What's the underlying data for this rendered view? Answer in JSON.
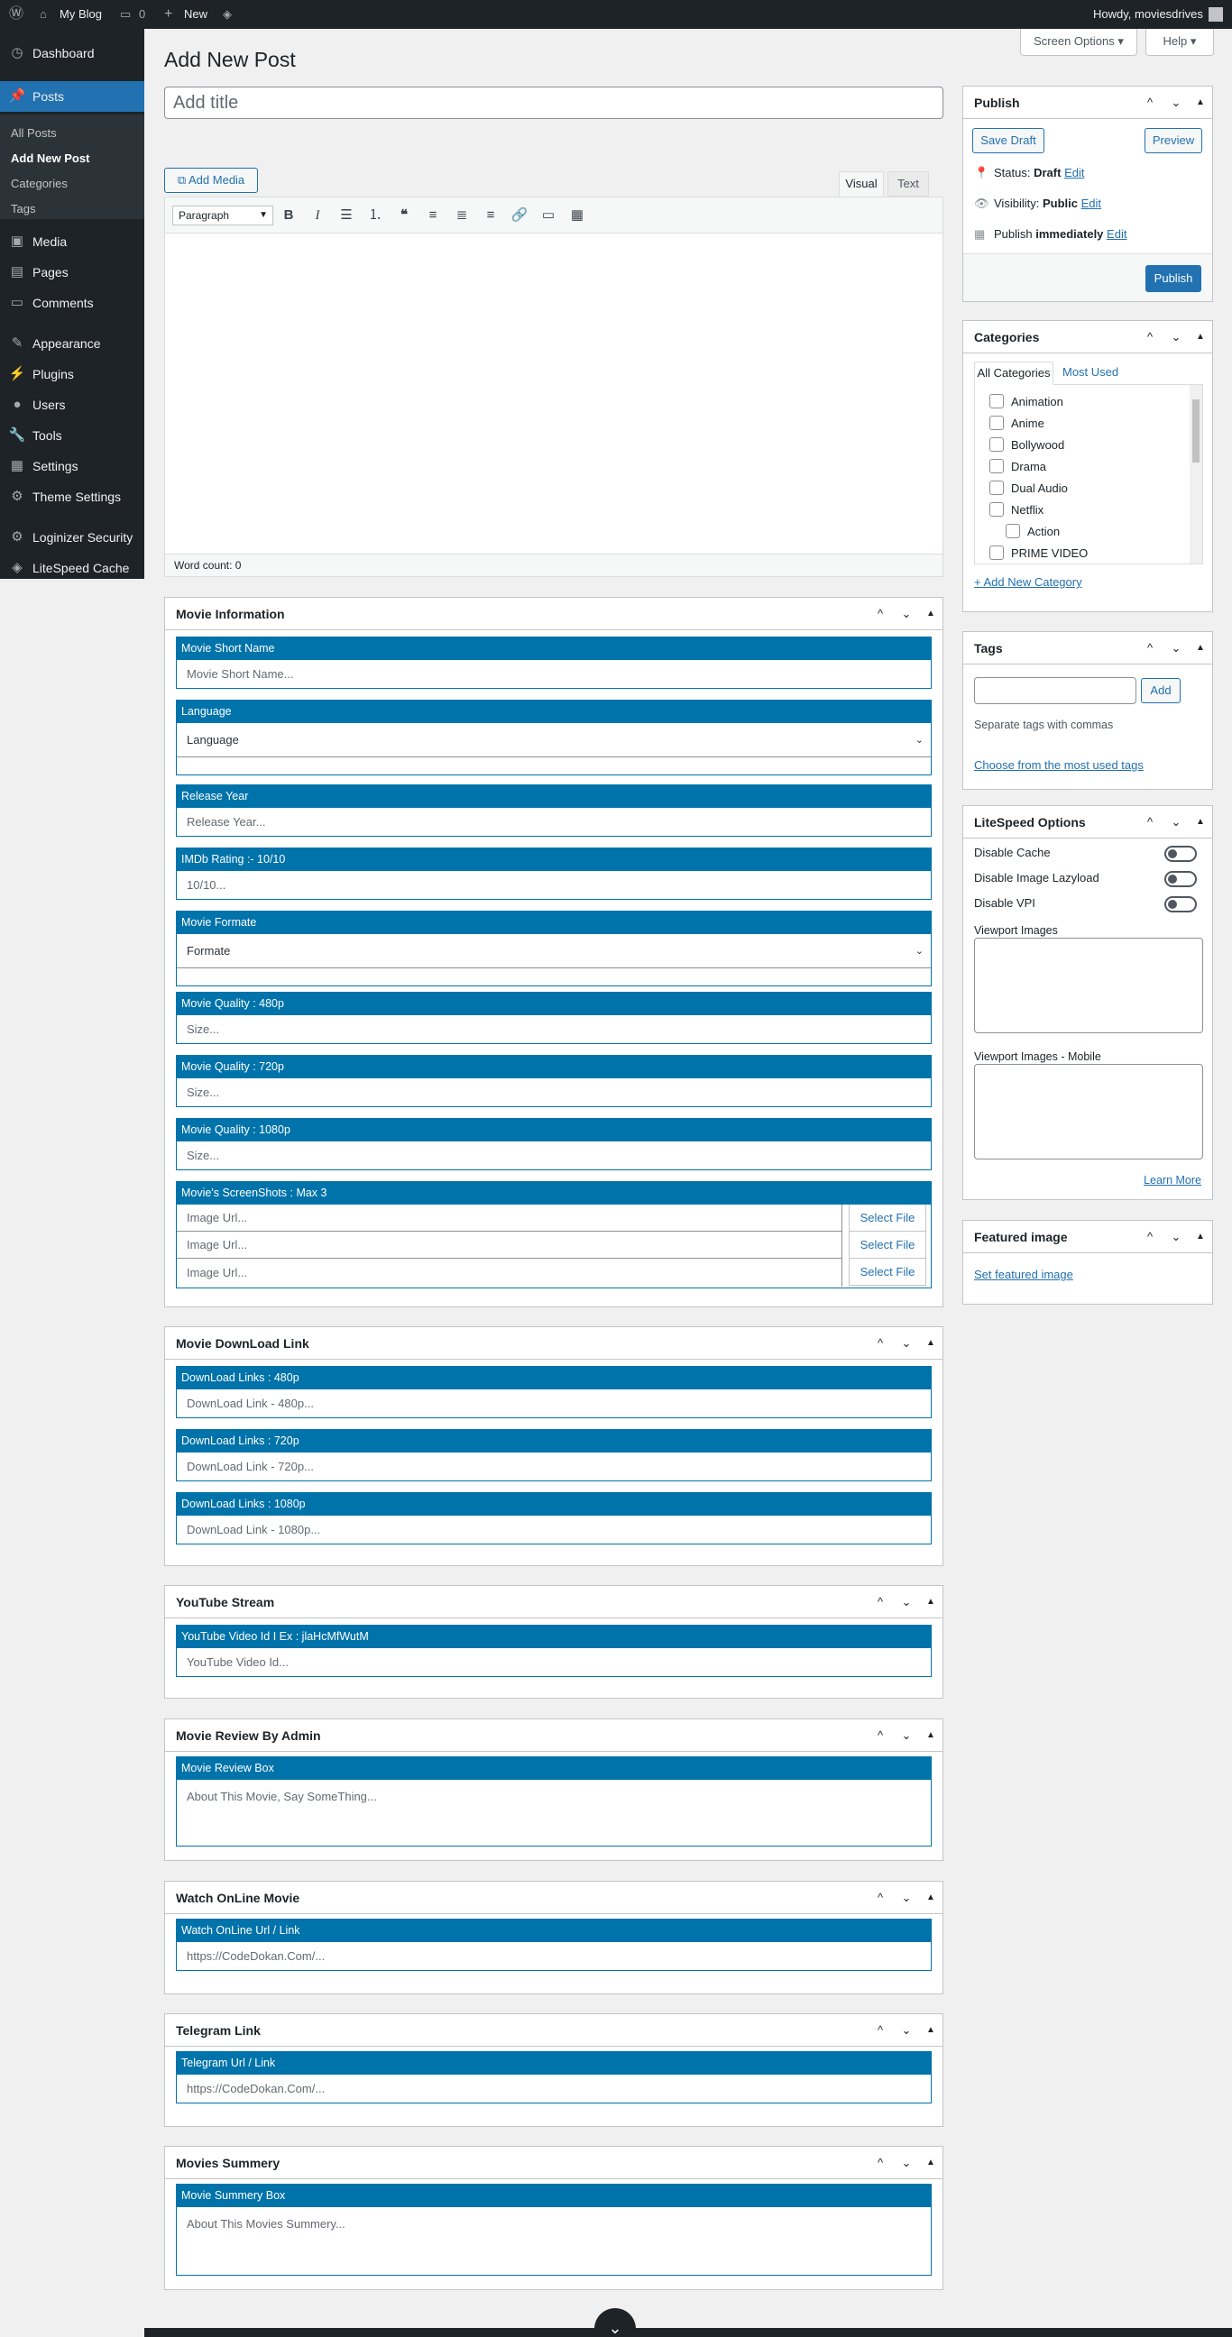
{
  "adminbar": {
    "site_name": "My Blog",
    "comments_count": "0",
    "new_label": "New",
    "howdy": "Howdy, moviesdrives"
  },
  "menu": {
    "dashboard": "Dashboard",
    "posts": "Posts",
    "sub": [
      "All Posts",
      "Add New Post",
      "Categories",
      "Tags"
    ],
    "media": "Media",
    "pages": "Pages",
    "comments": "Comments",
    "appearance": "Appearance",
    "plugins": "Plugins",
    "users": "Users",
    "tools": "Tools",
    "settings": "Settings",
    "theme_settings": "Theme Settings",
    "loginizer": "Loginizer Security",
    "litespeed": "LiteSpeed Cache"
  },
  "screen_options": "Screen Options",
  "help": "Help",
  "page_title": "Add New Post",
  "title_placeholder": "Add title",
  "editor": {
    "add_media": "Add Media",
    "tab_visual": "Visual",
    "tab_text": "Text",
    "format": "Paragraph",
    "word_count": "Word count: 0"
  },
  "publish": {
    "title": "Publish",
    "save_draft": "Save Draft",
    "preview": "Preview",
    "status_label": "Status:",
    "status_value": "Draft",
    "visibility_label": "Visibility:",
    "visibility_value": "Public",
    "publish_when": "Publish",
    "publish_when_value": "immediately",
    "edit": "Edit",
    "publish_button": "Publish"
  },
  "categories": {
    "title": "Categories",
    "tab_all": "All Categories",
    "tab_most": "Most Used",
    "items": [
      "Animation",
      "Anime",
      "Bollywood",
      "Drama",
      "Dual Audio",
      "Netflix",
      "Action",
      "PRIME VIDEO"
    ],
    "add_new": "+ Add New Category"
  },
  "tags": {
    "title": "Tags",
    "add": "Add",
    "hint": "Separate tags with commas",
    "choose": "Choose from the most used tags"
  },
  "litespeed": {
    "title": "LiteSpeed Options",
    "disable_cache": "Disable Cache",
    "disable_lazy": "Disable Image Lazyload",
    "disable_vpi": "Disable VPI",
    "viewport": "Viewport Images",
    "viewport_mobile": "Viewport Images - Mobile",
    "learn_more": "Learn More"
  },
  "featured": {
    "title": "Featured image",
    "set": "Set featured image"
  },
  "movie_info": {
    "title": "Movie Information",
    "short_name_label": "Movie Short Name",
    "short_name_ph": "Movie Short Name...",
    "language_label": "Language",
    "language_value": "Language",
    "year_label": "Release Year",
    "year_ph": "Release Year...",
    "imdb_label": "IMDb Rating :- 10/10",
    "imdb_ph": "10/10...",
    "formate_label": "Movie Formate",
    "formate_value": "Formate",
    "q480_label": "Movie Quality : 480p",
    "q720_label": "Movie Quality : 720p",
    "q1080_label": "Movie Quality : 1080p",
    "size_ph": "Size...",
    "shots_label": "Movie's ScreenShots : Max 3",
    "image_ph": "Image Url...",
    "select_file": "Select File"
  },
  "download": {
    "title": "Movie DownLoad Link",
    "l480": "DownLoad Links : 480p",
    "p480": "DownLoad Link - 480p...",
    "l720": "DownLoad Links : 720p",
    "p720": "DownLoad Link - 720p...",
    "l1080": "DownLoad Links : 1080p",
    "p1080": "DownLoad Link - 1080p..."
  },
  "youtube": {
    "title": "YouTube Stream",
    "label": "YouTube Video Id I Ex : jlaHcMfWutM",
    "ph": "YouTube Video Id..."
  },
  "review": {
    "title": "Movie Review By Admin",
    "label": "Movie Review Box",
    "ph": "About This Movie, Say SomeThing..."
  },
  "watch": {
    "title": "Watch OnLine Movie",
    "label": "Watch OnLine Url / Link",
    "ph": "https://CodeDokan.Com/..."
  },
  "telegram": {
    "title": "Telegram Link",
    "label": "Telegram Url / Link",
    "ph": "https://CodeDokan.Com/..."
  },
  "summery": {
    "title": "Movies Summery",
    "label": "Movie Summery Box",
    "ph": "About This Movies Summery..."
  }
}
